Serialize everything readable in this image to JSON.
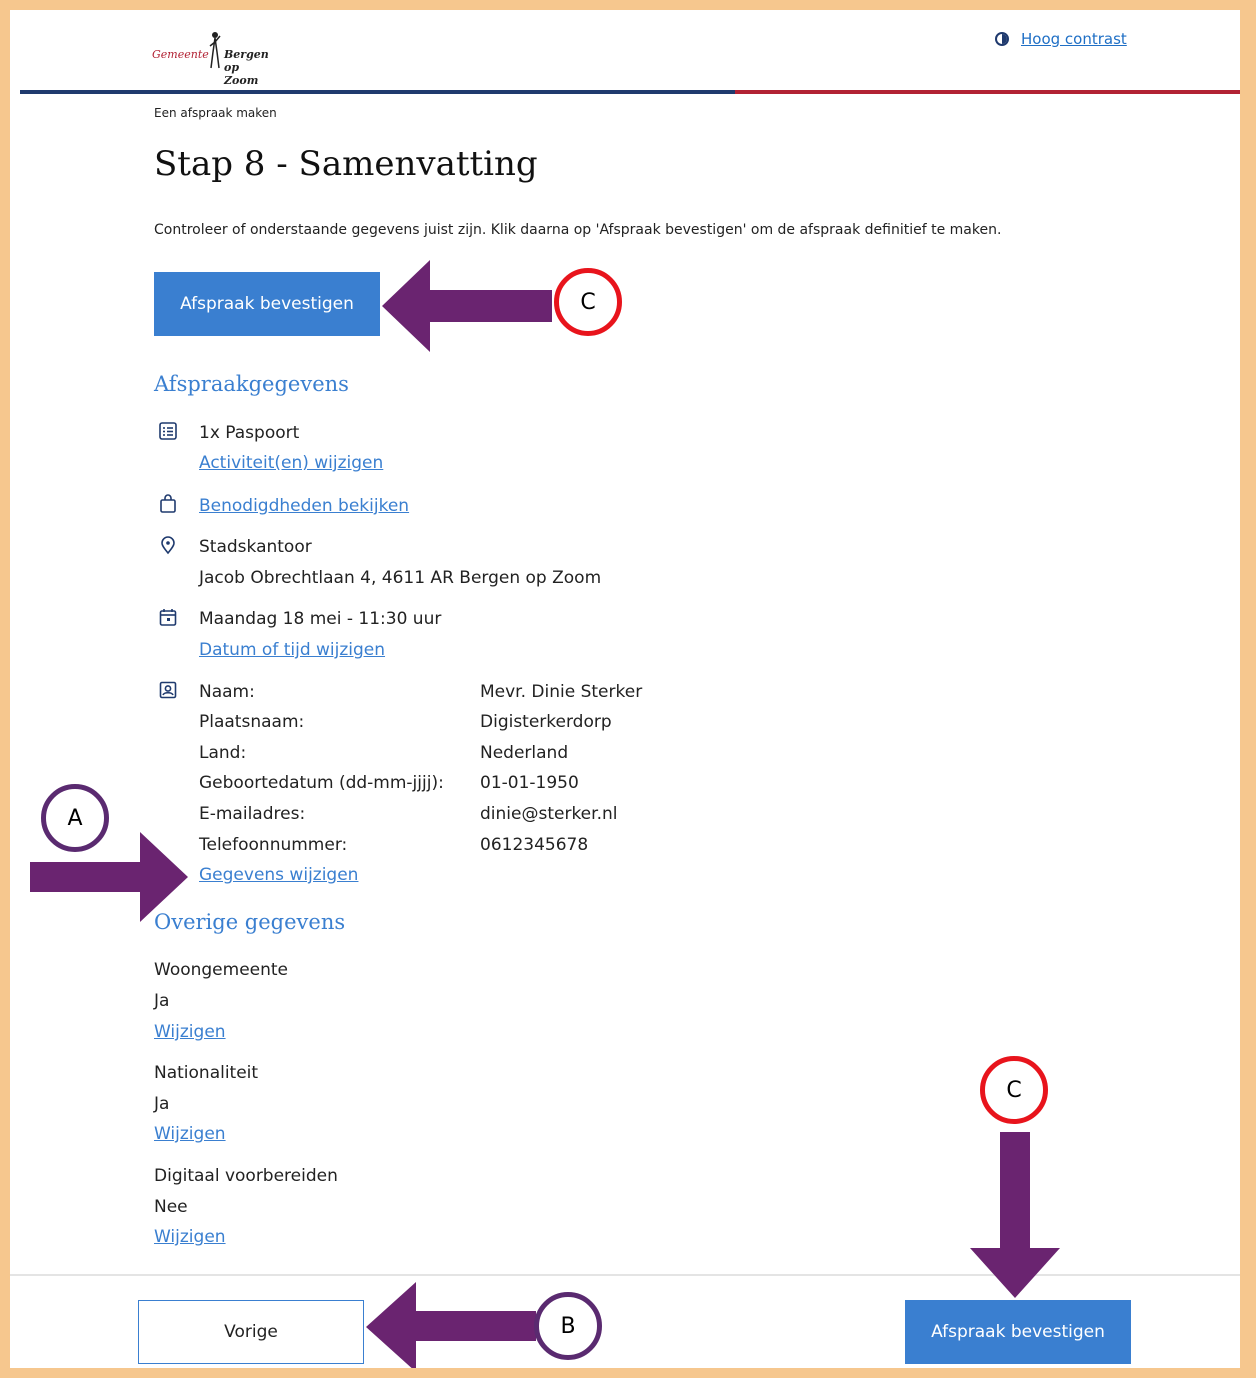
{
  "header": {
    "logo_prefix": "Gemeente",
    "logo_name": "Bergen op Zoom",
    "high_contrast_label": "Hoog contrast"
  },
  "breadcrumb": "Een afspraak maken",
  "page_title": "Stap 8 - Samenvatting",
  "intro_text": "Controleer of onderstaande gegevens juist zijn. Klik daarna op 'Afspraak bevestigen' om de afspraak definitief te maken.",
  "confirm_label": "Afspraak bevestigen",
  "appointment": {
    "heading": "Afspraakgegevens",
    "activity": "1x Paspoort",
    "change_activity_link": "Activiteit(en) wijzigen",
    "requirements_link": "Benodigdheden bekijken",
    "location_name": "Stadskantoor",
    "location_address": "Jacob Obrechtlaan 4, 4611 AR Bergen op Zoom",
    "datetime": "Maandag 18 mei - 11:30 uur",
    "change_datetime_link": "Datum of tijd wijzigen",
    "personal": [
      {
        "label": "Naam:",
        "value": "Mevr. Dinie Sterker"
      },
      {
        "label": "Plaatsnaam:",
        "value": "Digisterkerdorp"
      },
      {
        "label": "Land:",
        "value": "Nederland"
      },
      {
        "label": "Geboortedatum (dd-mm-jjjj):",
        "value": "01-01-1950"
      },
      {
        "label": "E-mailadres:",
        "value": "dinie@sterker.nl"
      },
      {
        "label": "Telefoonnummer:",
        "value": "0612345678"
      }
    ],
    "change_personal_link": "Gegevens wijzigen"
  },
  "other": {
    "heading": "Overige gegevens",
    "items": [
      {
        "label": "Woongemeente",
        "value": "Ja",
        "link": "Wijzigen"
      },
      {
        "label": "Nationaliteit",
        "value": "Ja",
        "link": "Wijzigen"
      },
      {
        "label": "Digitaal voorbereiden",
        "value": "Nee",
        "link": "Wijzigen"
      }
    ]
  },
  "footer": {
    "previous_label": "Vorige",
    "confirm_label": "Afspraak bevestigen"
  },
  "annotations": {
    "marker_a": "A",
    "marker_b": "B",
    "marker_c_top": "C",
    "marker_c_bottom": "C",
    "arrow_color": "#6a2470",
    "circle_red": "#e8141c",
    "circle_purple": "#5a2a70"
  },
  "colors": {
    "accent": "#3a7fd0",
    "navy": "#1f3a6e",
    "brand_red": "#b22234",
    "frame": "#f6c78e"
  }
}
